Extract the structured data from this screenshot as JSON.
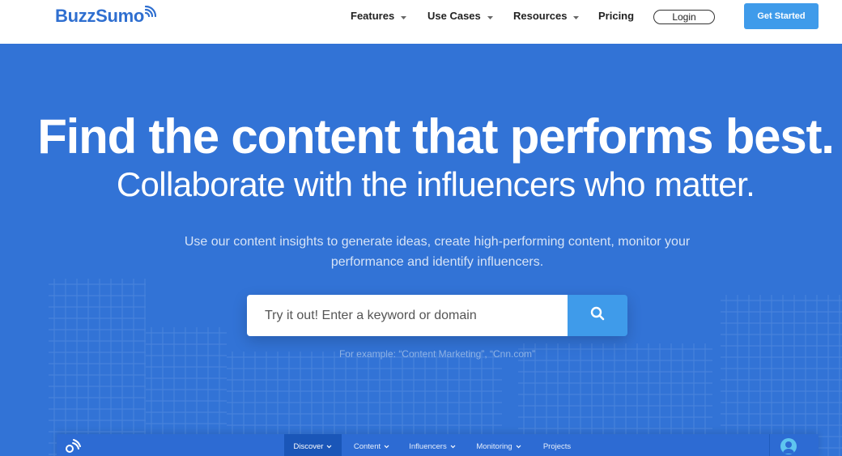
{
  "brand": {
    "name": "BuzzSumo",
    "color": "#2f6fd0",
    "logo_icon": "rss-signal-icon"
  },
  "nav": {
    "items": [
      {
        "label": "Features",
        "has_dropdown": true
      },
      {
        "label": "Use Cases",
        "has_dropdown": true
      },
      {
        "label": "Resources",
        "has_dropdown": true
      },
      {
        "label": "Pricing",
        "has_dropdown": false
      }
    ],
    "login_label": "Login",
    "cta_label": "Get Started"
  },
  "hero": {
    "headline": "Find the content that performs best.",
    "subheadline": "Collaborate with the influencers who matter.",
    "description": "Use our content insights to generate ideas, create high-performing content, monitor your performance and identify influencers.",
    "search_placeholder": "Try it out! Enter a keyword or domain",
    "search_icon": "search-icon",
    "example_text": "For example: “Content Marketing”, “Cnn.com”"
  },
  "app_preview": {
    "tabs": [
      {
        "label": "Discover",
        "has_dropdown": true,
        "active": true
      },
      {
        "label": "Content",
        "has_dropdown": true,
        "active": false
      },
      {
        "label": "Influencers",
        "has_dropdown": true,
        "active": false
      },
      {
        "label": "Monitoring",
        "has_dropdown": true,
        "active": false
      },
      {
        "label": "Projects",
        "has_dropdown": false,
        "active": false
      }
    ],
    "avatar_icon": "user-avatar-icon"
  },
  "colors": {
    "hero_bg": "#3273d6",
    "accent": "#3f9bea",
    "app_bar_bg": "#2d6bd3",
    "active_tab": "#1a56b8"
  }
}
